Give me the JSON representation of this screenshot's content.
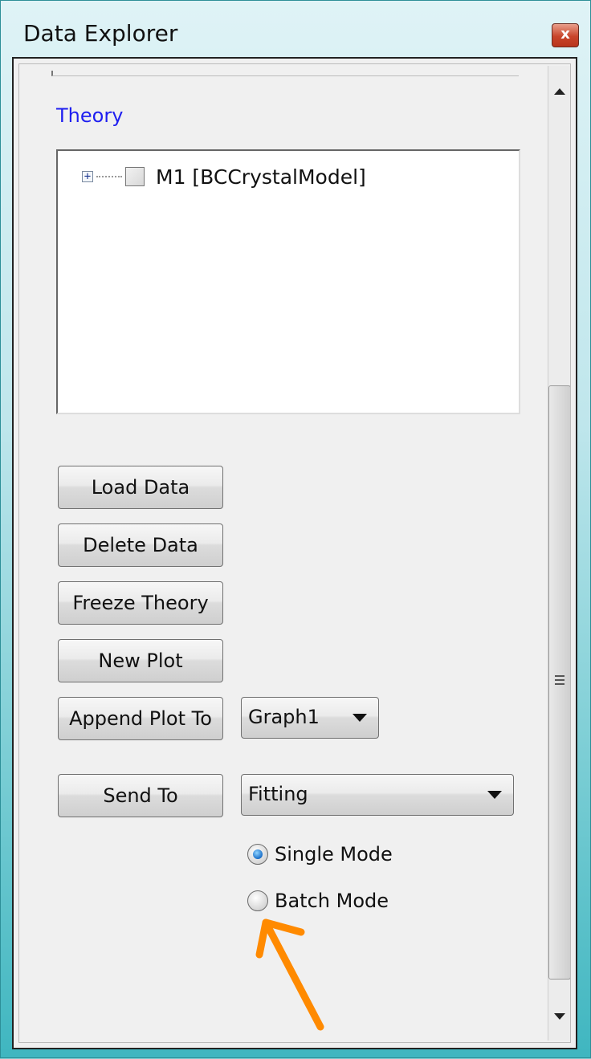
{
  "window": {
    "title": "Data Explorer",
    "close_label": "x"
  },
  "theory": {
    "label": "Theory",
    "tree_item": "M1 [BCCrystalModel]",
    "expander": "+"
  },
  "buttons": {
    "load_data": "Load Data",
    "delete_data": "Delete Data",
    "freeze_theory": "Freeze Theory",
    "new_plot": "New Plot",
    "append_plot_to": "Append Plot To",
    "send_to": "Send To"
  },
  "dropdowns": {
    "graph": "Graph1",
    "send_target": "Fitting"
  },
  "modes": {
    "single": "Single Mode",
    "batch": "Batch Mode",
    "selected": "single"
  },
  "annotation": {
    "arrow_color": "#ff8a00",
    "points_to": "batch-mode-radio"
  },
  "colors": {
    "theory_label": "#1e1ef0"
  }
}
